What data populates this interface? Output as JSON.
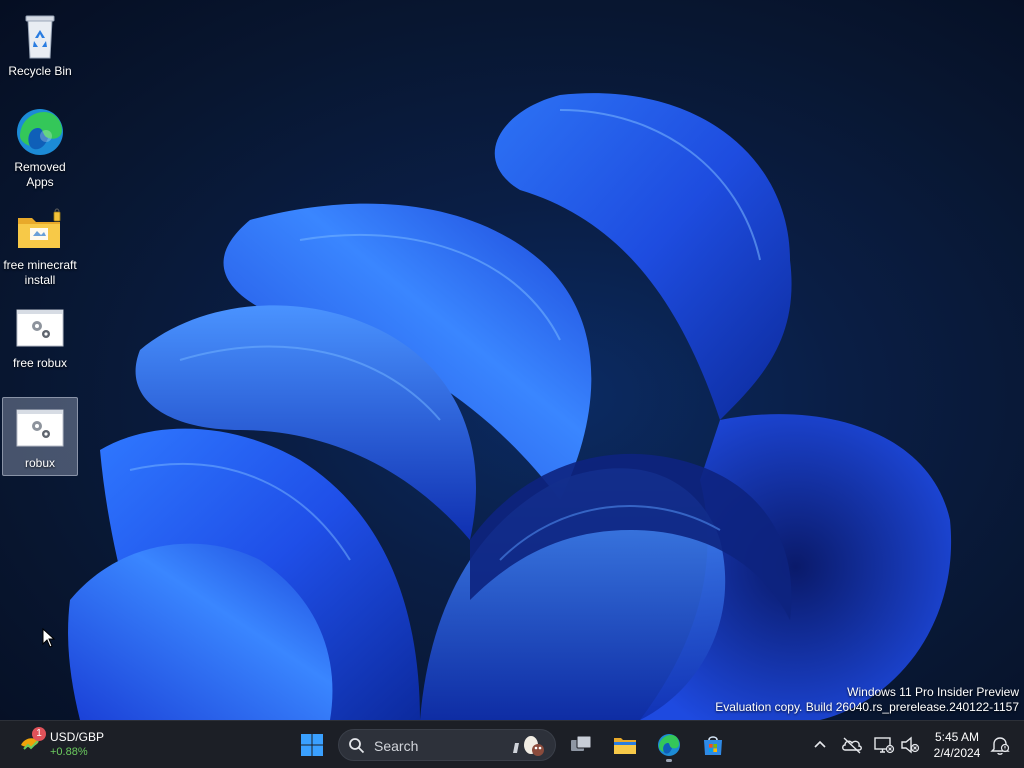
{
  "desktop": {
    "icons": [
      {
        "label": "Recycle Bin"
      },
      {
        "label": "Removed Apps"
      },
      {
        "label": "free minecraft install"
      },
      {
        "label": "free robux"
      },
      {
        "label": "robux"
      }
    ],
    "watermark": {
      "line1": "Windows 11 Pro Insider Preview",
      "line2": "Evaluation copy. Build 26040.rs_prerelease.240122-1157"
    }
  },
  "taskbar": {
    "widget": {
      "badge": "1",
      "name": "USD/GBP",
      "change": "+0.88%"
    },
    "search": {
      "placeholder": "Search"
    },
    "apps": [
      {
        "icon": "windows-start-icon"
      },
      {
        "icon": "task-view-icon"
      },
      {
        "icon": "file-explorer-icon"
      },
      {
        "icon": "edge-icon"
      },
      {
        "icon": "microsoft-store-icon"
      }
    ],
    "tray": {
      "time": "5:45 AM",
      "date": "2/4/2024"
    }
  },
  "colors": {
    "accent": "#1f5cff",
    "taskbar_bg": "#1c1f26",
    "change_positive": "#6ccb5f",
    "badge": "#e0525a"
  }
}
